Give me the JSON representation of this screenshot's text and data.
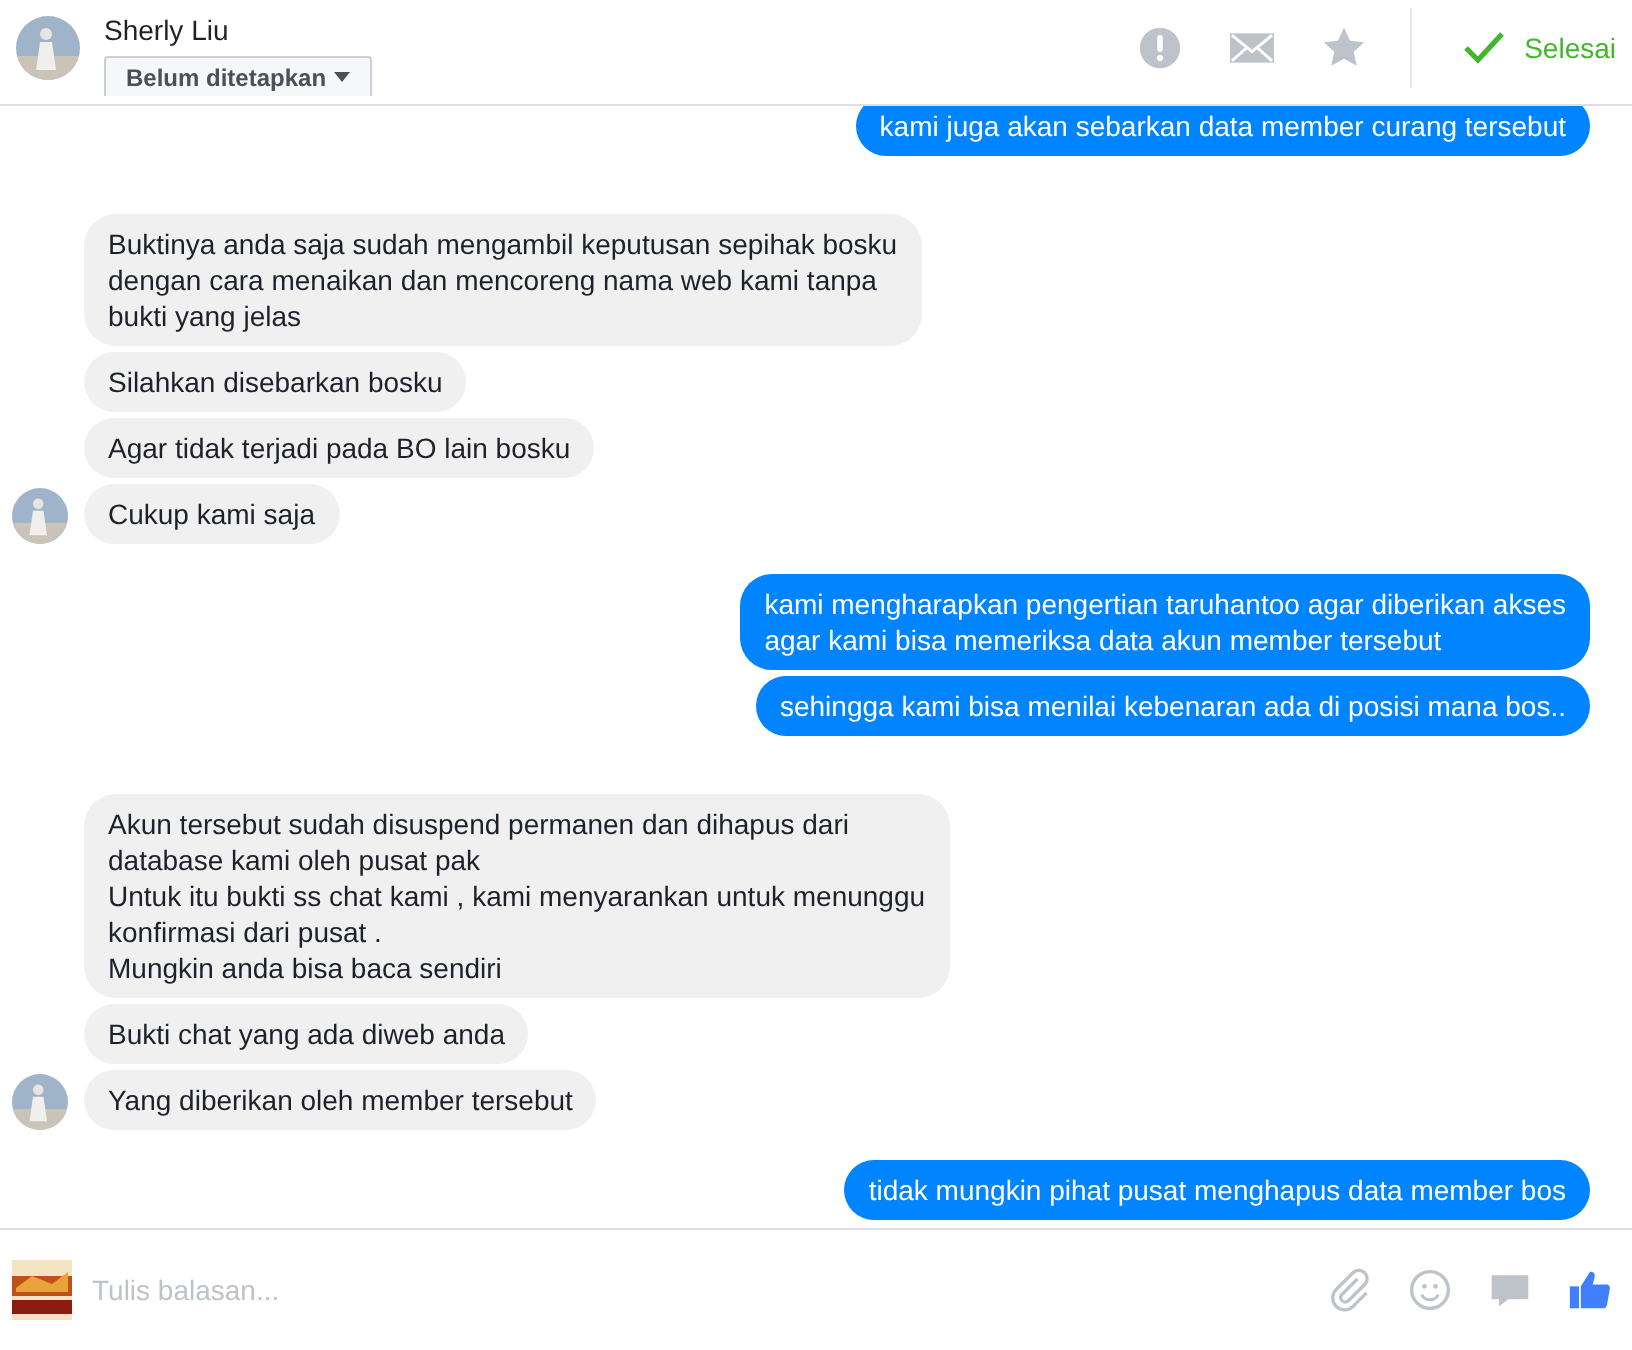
{
  "header": {
    "contact_name": "Sherly Liu",
    "label_dropdown": "Belum ditetapkan",
    "done_button": "Selesai"
  },
  "messages": [
    {
      "kind": "outgoing",
      "bubbles": [
        "kami juga akan sebarkan data member curang tersebut"
      ]
    },
    {
      "kind": "incoming",
      "bubbles": [
        "Buktinya anda saja sudah mengambil keputusan sepihak bosku\ndengan cara menaikan dan mencoreng nama web kami tanpa\nbukti yang jelas",
        "Silahkan disebarkan bosku",
        "Agar tidak terjadi pada BO lain bosku",
        "Cukup kami saja"
      ]
    },
    {
      "kind": "outgoing",
      "bubbles": [
        "kami mengharapkan pengertian taruhantoo agar diberikan akses\nagar kami bisa memeriksa data akun member tersebut",
        "sehingga kami bisa menilai kebenaran ada di posisi mana bos.."
      ]
    },
    {
      "kind": "incoming",
      "bubbles": [
        "Akun tersebut sudah disuspend permanen dan dihapus dari\ndatabase kami oleh pusat pak\nUntuk itu bukti ss chat kami ,  kami menyarankan untuk menunggu\nkonfirmasi dari pusat .\nMungkin anda bisa baca sendiri",
        "Bukti chat yang ada diweb anda",
        "Yang diberikan oleh member tersebut"
      ]
    },
    {
      "kind": "outgoing",
      "bubbles": [
        "tidak mungkin pihat pusat menghapus data member bos"
      ]
    }
  ],
  "composer": {
    "placeholder": "Tulis balasan..."
  }
}
